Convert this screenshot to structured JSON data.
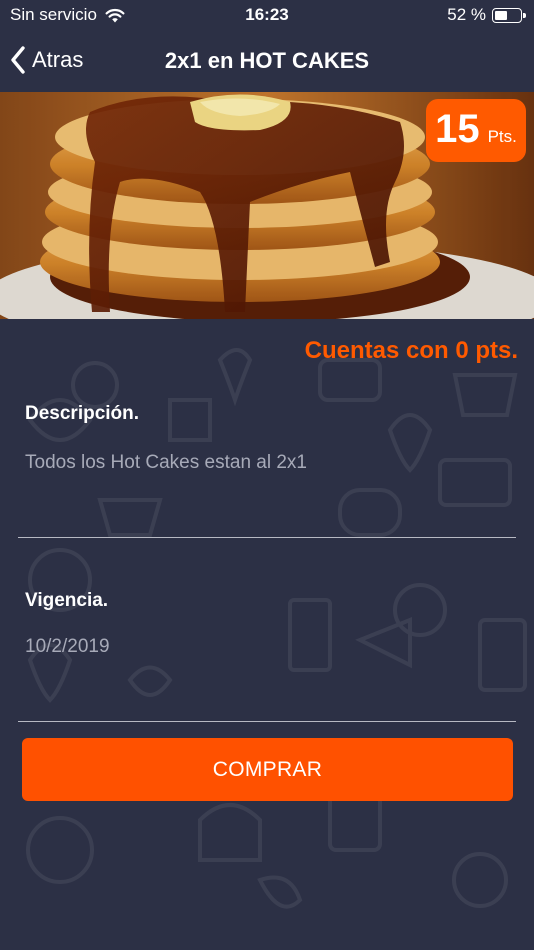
{
  "status_bar": {
    "carrier": "Sin servicio",
    "time": "16:23",
    "battery_percent": "52 %",
    "battery_level": 0.52
  },
  "nav": {
    "back_label": "Atras",
    "title": "2x1 en HOT CAKES"
  },
  "offer": {
    "points_value": "15",
    "points_unit": "Pts.",
    "balance_text": "Cuentas con 0 pts.",
    "description_label": "Descripción.",
    "description_value": "Todos los Hot Cakes estan al 2x1",
    "validity_label": "Vigencia.",
    "validity_value": "10/2/2019",
    "buy_label": "COMPRAR"
  },
  "colors": {
    "background": "#2c3045",
    "accent": "#ff5a00",
    "muted_text": "#a7aab8"
  },
  "icons": [
    "wifi-icon",
    "battery-icon",
    "back-chevron-icon",
    "pancakes-photo"
  ]
}
